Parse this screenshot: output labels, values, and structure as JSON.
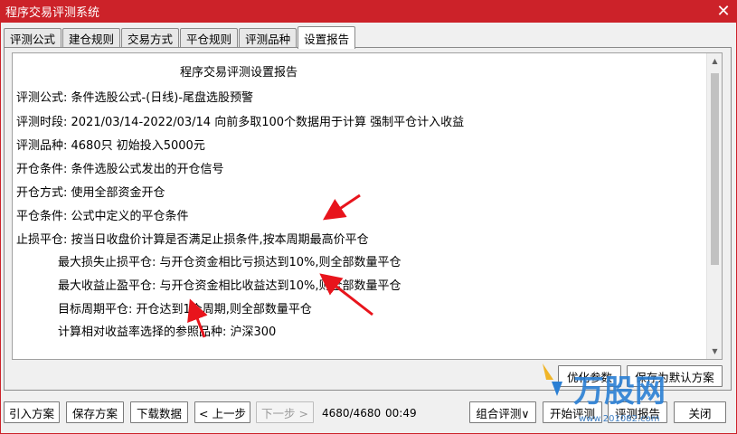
{
  "window": {
    "title": "程序交易评测系统",
    "close_glyph": "✕"
  },
  "tabs": [
    {
      "label": "评测公式",
      "active": false
    },
    {
      "label": "建仓规则",
      "active": false
    },
    {
      "label": "交易方式",
      "active": false
    },
    {
      "label": "平仓规则",
      "active": false
    },
    {
      "label": "评测品种",
      "active": false
    },
    {
      "label": "设置报告",
      "active": true
    }
  ],
  "report": {
    "title": "程序交易评测设置报告",
    "lines": [
      "评测公式: 条件选股公式-(日线)-尾盘选股预警",
      "评测时段: 2021/03/14-2022/03/14 向前多取100个数据用于计算 强制平仓计入收益",
      "评测品种: 4680只 初始投入5000元",
      "开仓条件: 条件选股公式发出的开仓信号",
      "开仓方式: 使用全部资金开仓",
      "平仓条件: 公式中定义的平仓条件",
      "止损平仓: 按当日收盘价计算是否满足止损条件,按本周期最高价平仓"
    ],
    "indented_lines": [
      "最大损失止损平仓: 与开仓资金相比亏损达到10%,则全部数量平仓",
      "最大收益止盈平仓: 与开仓资金相比收益达到10%,则全部数量平仓",
      "目标周期平仓: 开仓达到1个周期,则全部数量平仓",
      "计算相对收益率选择的参照品种: 沪深300"
    ]
  },
  "panel_buttons": {
    "optimize": "优化参数",
    "save_default": "保存为默认方案"
  },
  "bottom_bar": {
    "import_plan": "引入方案",
    "save_plan": "保存方案",
    "download_data": "下载数据",
    "prev_step": "< 上一步",
    "next_step": "下一步 >",
    "progress_count": "4680/4680",
    "elapsed_time": "00:49",
    "combo_eval": "组合评测∨",
    "start_eval": "开始评测",
    "eval_report": "评测报告",
    "close": "关闭"
  },
  "watermark": {
    "brand": "万股网",
    "url": "www.201082.com"
  },
  "colors": {
    "title_bar": "#cc2229",
    "annotation_arrow": "#e8141c",
    "watermark": "#2a7fd4"
  },
  "icons": [
    "close-icon",
    "scroll-up-icon",
    "scroll-down-icon",
    "annotation-arrow-icon",
    "watermark-logo-icon"
  ]
}
